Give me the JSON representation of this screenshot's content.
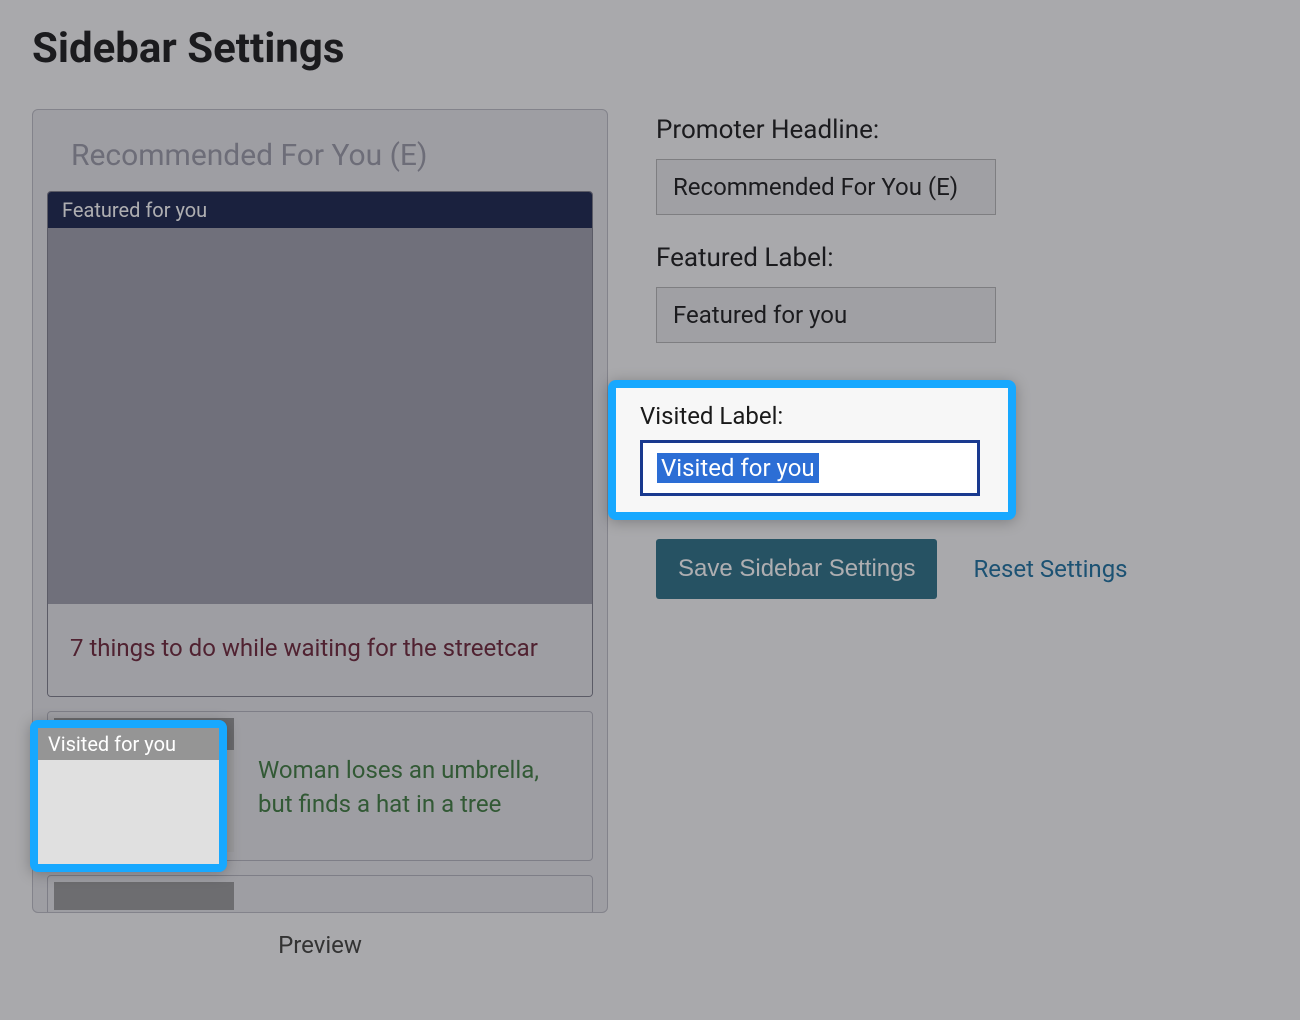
{
  "page": {
    "title": "Sidebar Settings",
    "preview_label": "Preview"
  },
  "form": {
    "promoter_label": "Promoter Headline:",
    "promoter_value": "Recommended For You (E)",
    "featured_label_label": "Featured Label:",
    "featured_label_value": "Featured for you",
    "visited_label_label": "Visited Label:",
    "visited_label_value": "Visited for you",
    "save_button": "Save Sidebar Settings",
    "reset_link": "Reset Settings"
  },
  "preview": {
    "headline": "Recommended For You (E)",
    "featured_badge": "Featured for you",
    "featured_article_title": "7 things to do while waiting for the streetcar",
    "visited_badge": "Visited for you",
    "visited_article_title": "Woman loses an umbrella, but finds a hat in a tree"
  }
}
